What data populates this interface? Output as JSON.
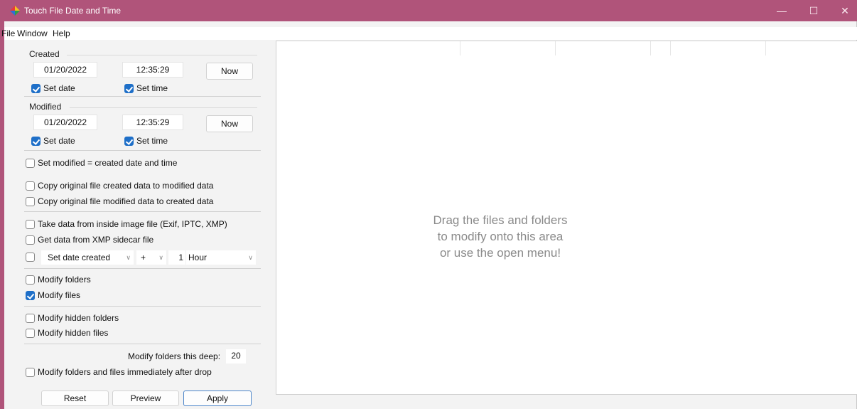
{
  "window": {
    "title": "Touch File Date and Time"
  },
  "window_controls": {
    "minimize": "—",
    "maximize": "☐",
    "close": "✕"
  },
  "menu": [
    "File",
    "Window",
    "Help"
  ],
  "created": {
    "label": "Created",
    "date": "01/20/2022",
    "time": "12:35:29",
    "now_label": "Now",
    "set_date_label": "Set date",
    "set_date_checked": true,
    "set_time_label": "Set time",
    "set_time_checked": true
  },
  "modified": {
    "label": "Modified",
    "date": "01/20/2022",
    "time": "12:35:29",
    "now_label": "Now",
    "set_date_label": "Set date",
    "set_date_checked": true,
    "set_time_label": "Set time",
    "set_time_checked": true
  },
  "options": {
    "set_modified_eq_created": {
      "label": "Set modified = created date and time",
      "checked": false
    },
    "copy_created_to_modified": {
      "label": "Copy original file created data to modified data",
      "checked": false
    },
    "copy_modified_to_created": {
      "label": "Copy original file modified data to created data",
      "checked": false
    },
    "take_from_image": {
      "label": "Take data from inside image file (Exif, IPTC, XMP)",
      "checked": false
    },
    "xmp_sidecar": {
      "label": "Get data from XMP sidecar file",
      "checked": false
    },
    "adjust": {
      "checked": false,
      "target": "Set date created",
      "operator": "+",
      "amount": "1",
      "unit": "Hour"
    },
    "modify_folders": {
      "label": "Modify folders",
      "checked": false
    },
    "modify_files": {
      "label": "Modify files",
      "checked": true
    },
    "modify_hidden_folders": {
      "label": "Modify hidden folders",
      "checked": false
    },
    "modify_hidden_files": {
      "label": "Modify hidden files",
      "checked": false
    },
    "depth_label": "Modify folders this deep:",
    "depth_value": "20",
    "immediate": {
      "label": "Modify folders and files immediately after drop",
      "checked": false
    }
  },
  "buttons": {
    "reset": "Reset",
    "preview": "Preview",
    "apply": "Apply"
  },
  "drop_area": {
    "line1": "Drag the files and folders",
    "line2": "to modify onto this area",
    "line3": "or use the open menu!"
  },
  "colors": {
    "titlebar": "#b0547a",
    "checkbox_accent": "#1e6fc8"
  },
  "icons": {
    "app": "colorful-diamond-app-icon"
  }
}
